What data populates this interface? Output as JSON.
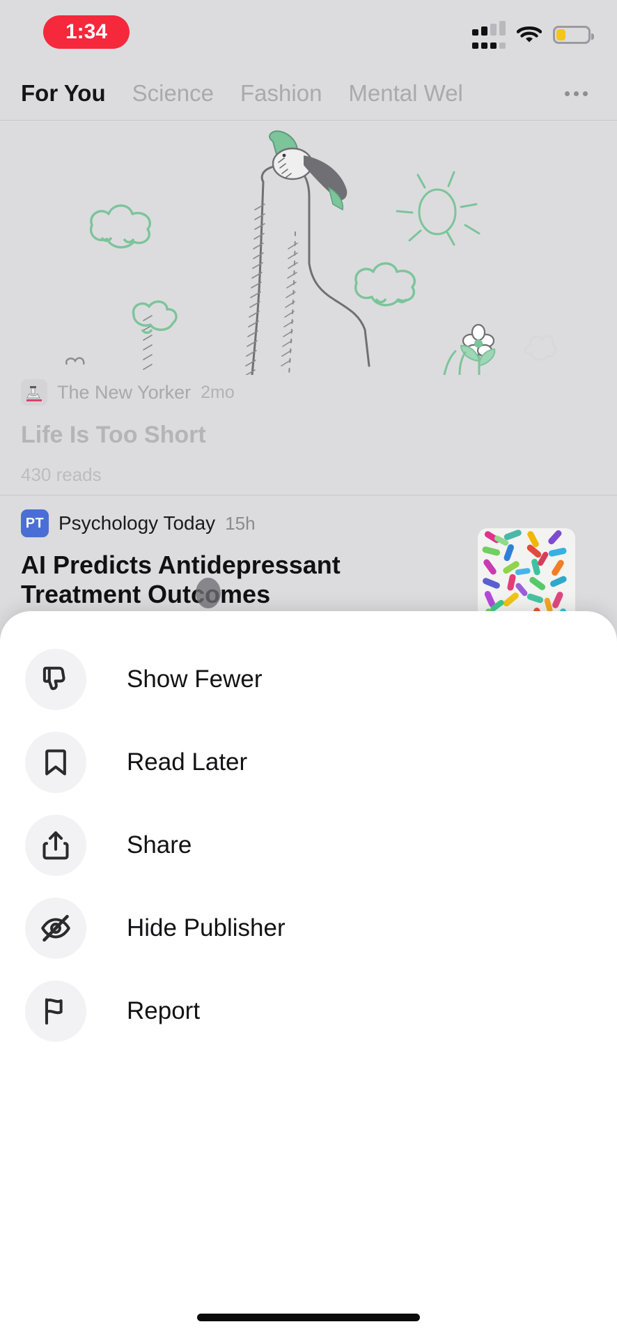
{
  "status_bar": {
    "time": "1:34",
    "time_pill_color": "#f5283c",
    "cellular_icon": "dual-sim-signal-icon",
    "wifi_icon": "wifi-icon",
    "battery_icon": "battery-low-icon",
    "battery_level_percent": 30,
    "battery_color": "#f5c518"
  },
  "tabs": {
    "items": [
      {
        "label": "For You",
        "active": true
      },
      {
        "label": "Science",
        "active": false
      },
      {
        "label": "Fashion",
        "active": false
      },
      {
        "label": "Mental Wel",
        "active": false
      }
    ],
    "overflow_icon": "more-horizontal-icon"
  },
  "feed": {
    "story_one": {
      "illustration": "bird-on-finger-line-drawing",
      "publisher": "The New Yorker",
      "publisher_logo": "new-yorker-eustace-icon",
      "time": "2mo",
      "headline": "Life Is Too Short",
      "reads": "430 reads"
    },
    "story_two": {
      "publisher": "Psychology Today",
      "publisher_logo_text": "PT",
      "publisher_logo_color": "#4a6fd4",
      "time": "15h",
      "headline": "AI Predicts Antidepressant Treatment Outcomes",
      "thumbnail": "colorful-pills-capsules-image"
    }
  },
  "action_sheet": {
    "items": [
      {
        "label": "Show Fewer",
        "icon": "thumbs-down-icon"
      },
      {
        "label": "Read Later",
        "icon": "bookmark-icon"
      },
      {
        "label": "Share",
        "icon": "share-icon"
      },
      {
        "label": "Hide Publisher",
        "icon": "eye-slash-icon"
      },
      {
        "label": "Report",
        "icon": "flag-icon"
      }
    ]
  },
  "home_indicator": {
    "icon": "home-indicator-bar"
  }
}
